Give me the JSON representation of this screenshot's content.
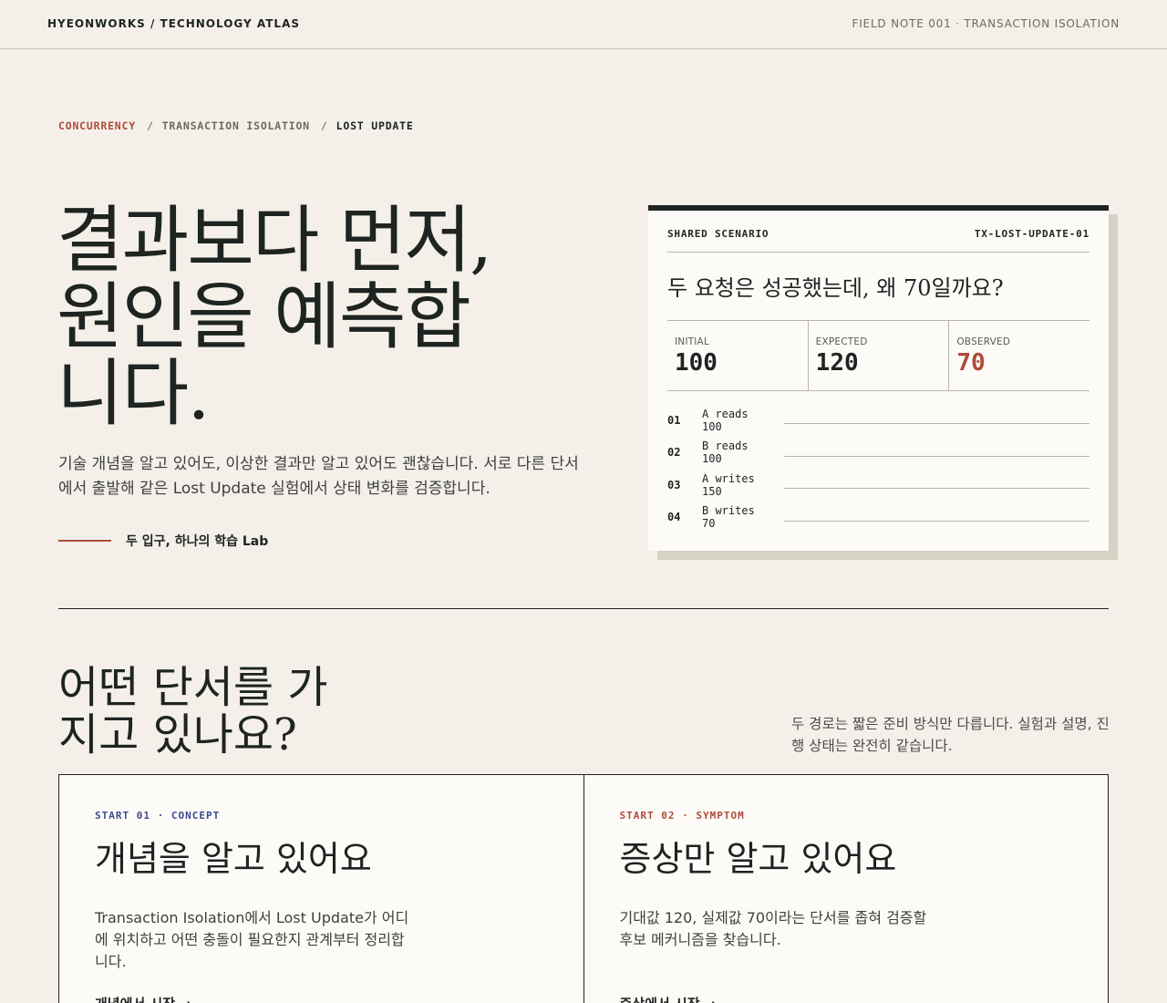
{
  "header": {
    "brand": "HYEONWORKS / TECHNOLOGY ATLAS",
    "note": "FIELD NOTE 001 · TRANSACTION ISOLATION"
  },
  "breadcrumb": {
    "items": [
      "CONCURRENCY",
      "TRANSACTION ISOLATION",
      "LOST UPDATE"
    ],
    "separator": "/"
  },
  "hero": {
    "title_lines": [
      "결과보다 먼저,",
      "원인을 예측합",
      "니다."
    ],
    "description": "기술 개념을 알고 있어도, 이상한 결과만 알고 있어도 괜찮습니다. 서로 다른 단서에서 출발해 같은 Lost Update 실험에서 상태 변화를 검증합니다.",
    "tag": "두 입구, 하나의 학습 Lab"
  },
  "scenario": {
    "label": "SHARED SCENARIO",
    "id": "TX-LOST-UPDATE-01",
    "question": "두 요청은 성공했는데, 왜 70일까요?",
    "stats": [
      {
        "label": "INITIAL",
        "value": "100"
      },
      {
        "label": "EXPECTED",
        "value": "120"
      },
      {
        "label": "OBSERVED",
        "value": "70"
      }
    ],
    "steps": [
      {
        "num": "01",
        "action": "A reads",
        "value": "100"
      },
      {
        "num": "02",
        "action": "B reads",
        "value": "100"
      },
      {
        "num": "03",
        "action": "A writes",
        "value": "150"
      },
      {
        "num": "04",
        "action": "B writes",
        "value": "70"
      }
    ],
    "observed_color": "#b14a38"
  },
  "section": {
    "title_lines": [
      "어떤 단서를 가",
      "지고 있나요?"
    ],
    "description": "두 경로는 짧은 준비 방식만 다릅니다. 실험과 설명, 진행 상태는 완전히 같습니다."
  },
  "entries": [
    {
      "kicker": "START 01 · CONCEPT",
      "title": "개념을 알고 있어요",
      "description": "Transaction Isolation에서 Lost Update가 어디에 위치하고 어떤 충돌이 필요한지 관계부터 정리합니다.",
      "cta": "개념에서 시작 →"
    },
    {
      "kicker": "START 02 · SYMPTOM",
      "title": "증상만 알고 있어요",
      "description": "기대값 120, 실제값 70이라는 단서를 좁혀 검증할 후보 메커니즘을 찾습니다.",
      "cta": "증상에서 시작 →"
    }
  ],
  "colors": {
    "background": "#f4f0e9",
    "accent_red": "#b14a38",
    "accent_blue": "#3d4b8f",
    "ink": "#1d2421"
  }
}
